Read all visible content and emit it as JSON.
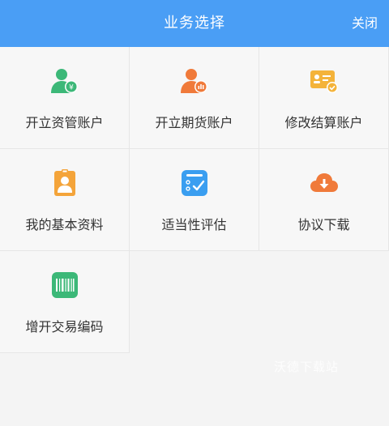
{
  "header": {
    "title": "业务选择",
    "close_label": "关闭",
    "background": "#4a9ef5"
  },
  "tiles": [
    {
      "label": "开立资管账户",
      "icon": "user-money-icon",
      "color": "#3cb878"
    },
    {
      "label": "开立期货账户",
      "icon": "user-chart-icon",
      "color": "#f07a3a"
    },
    {
      "label": "修改结算账户",
      "icon": "card-check-icon",
      "color": "#f4b33a"
    },
    {
      "label": "我的基本资料",
      "icon": "id-badge-icon",
      "color": "#f4a43a"
    },
    {
      "label": "适当性评估",
      "icon": "checklist-icon",
      "color": "#3a9ef0"
    },
    {
      "label": "协议下载",
      "icon": "cloud-download-icon",
      "color": "#f07a3a"
    },
    {
      "label": "增开交易编码",
      "icon": "barcode-icon",
      "color": "#3cb878"
    }
  ],
  "watermark": "沃德下载站"
}
